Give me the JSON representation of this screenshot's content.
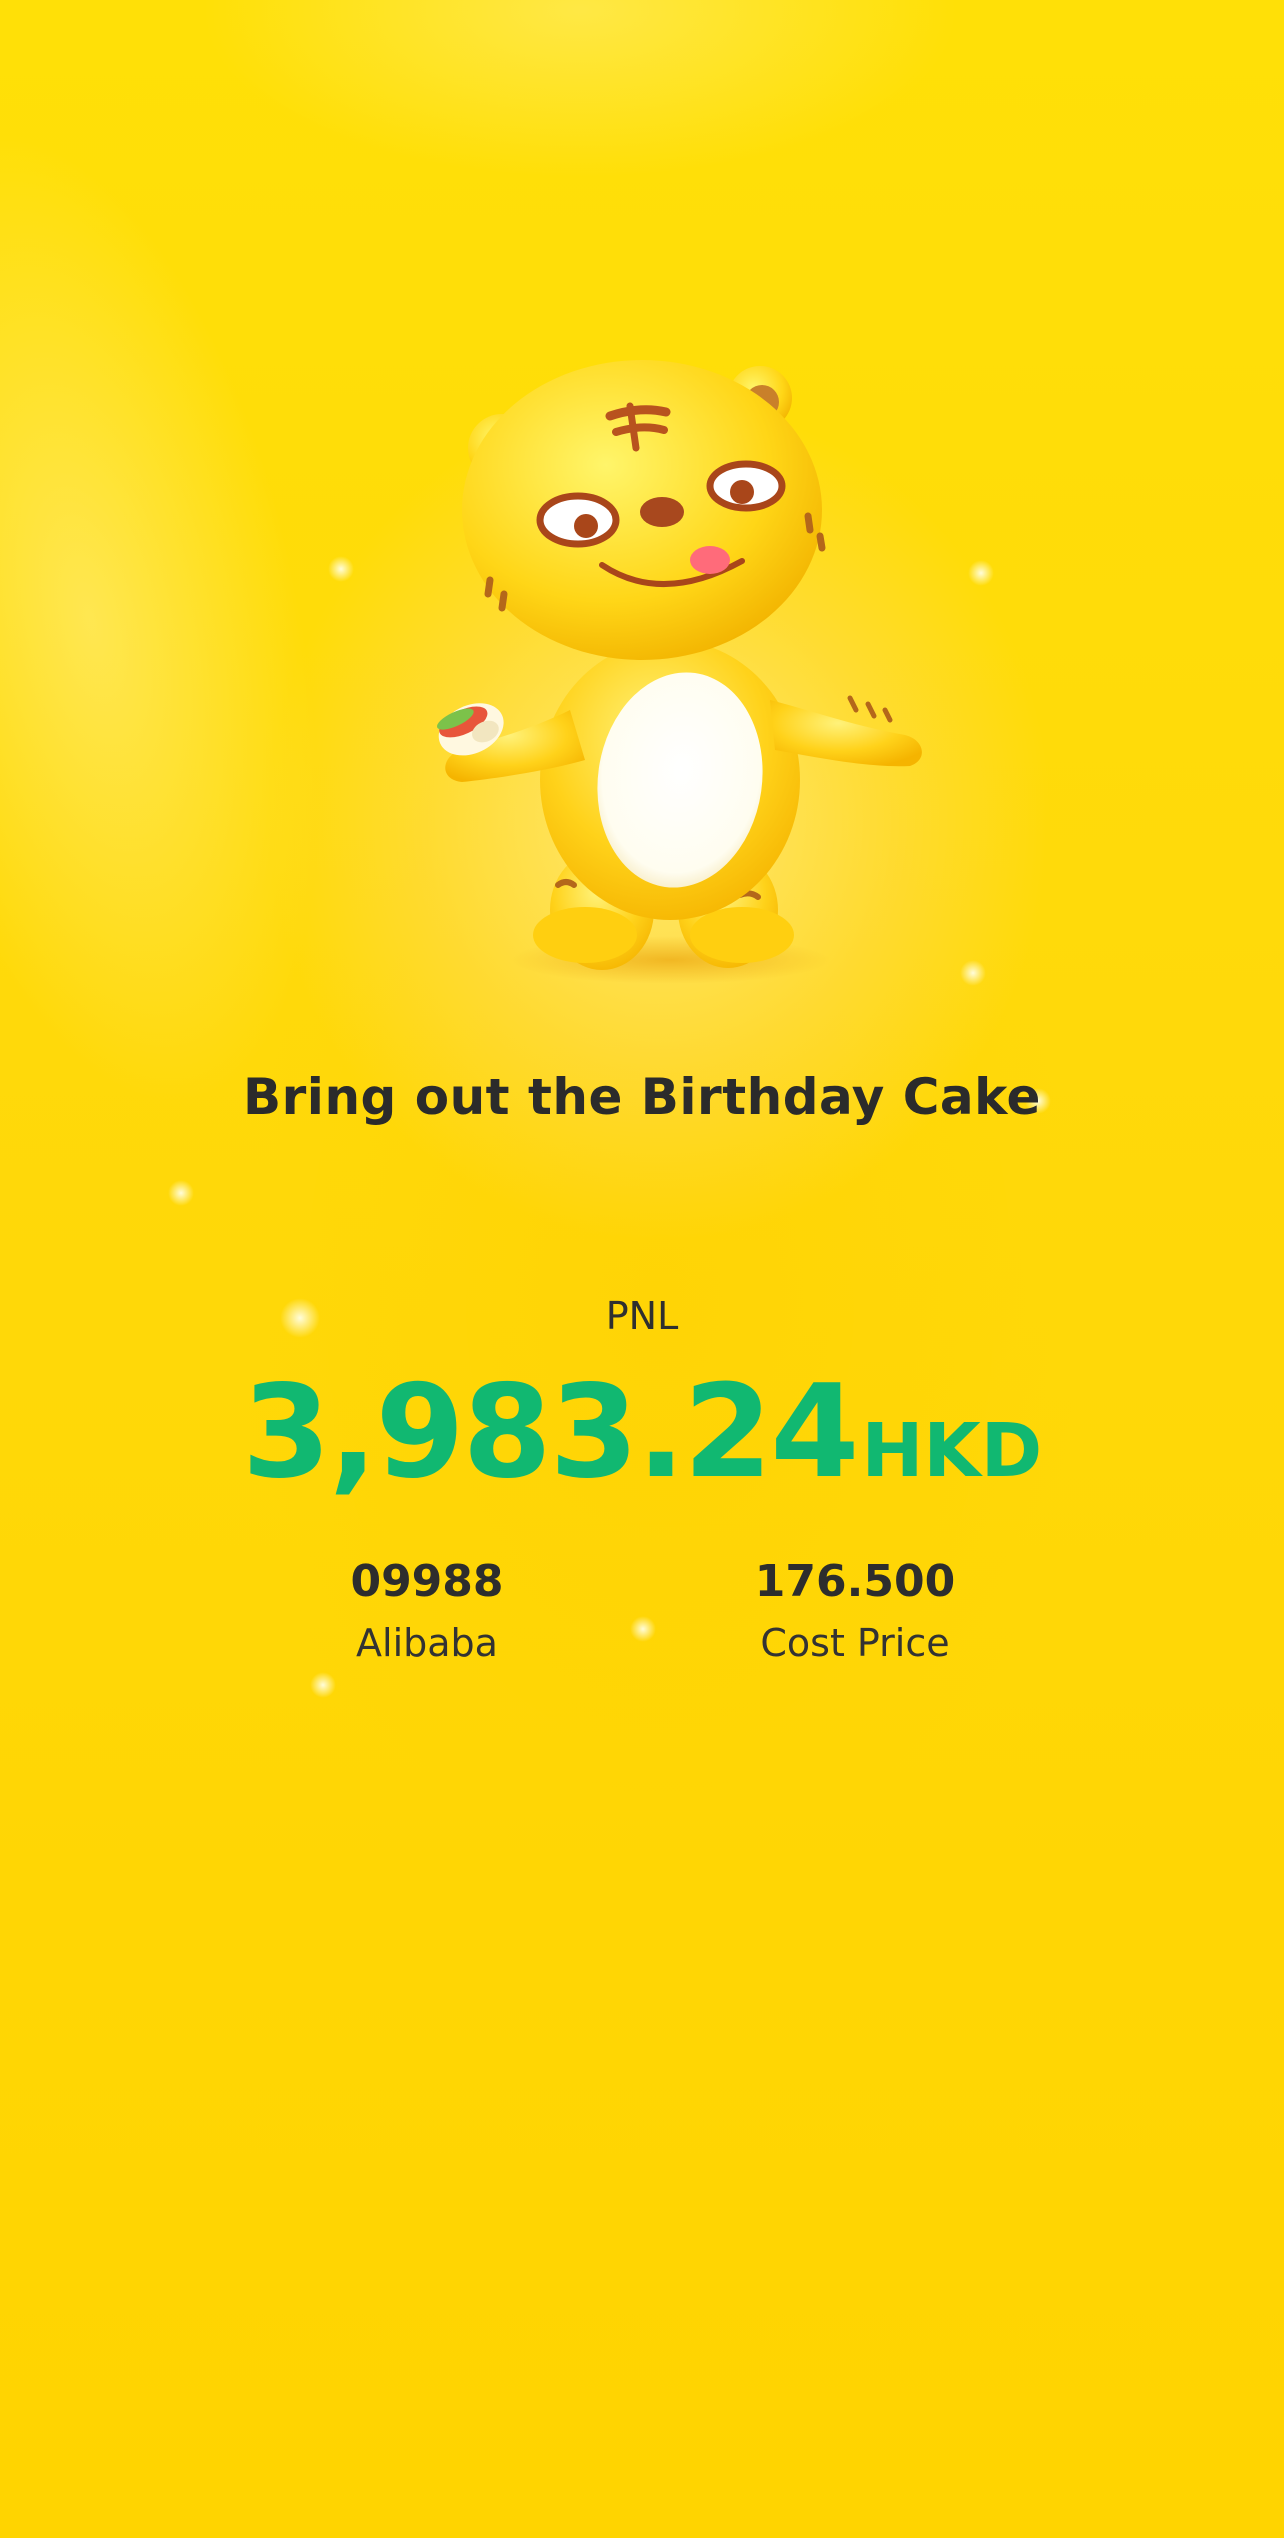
{
  "headline": "Bring out the Birthday Cake",
  "pnl": {
    "label": "PNL",
    "amount": "3,983.24",
    "currency": "HKD",
    "color": "#11b871"
  },
  "stock": {
    "code": "09988",
    "name": "Alibaba"
  },
  "cost": {
    "value": "176.500",
    "label": "Cost Price"
  },
  "colors": {
    "background": "#ffd90a",
    "text": "#2b2b2b"
  },
  "icons": {
    "mascot": "tiger-mascot-icon"
  }
}
